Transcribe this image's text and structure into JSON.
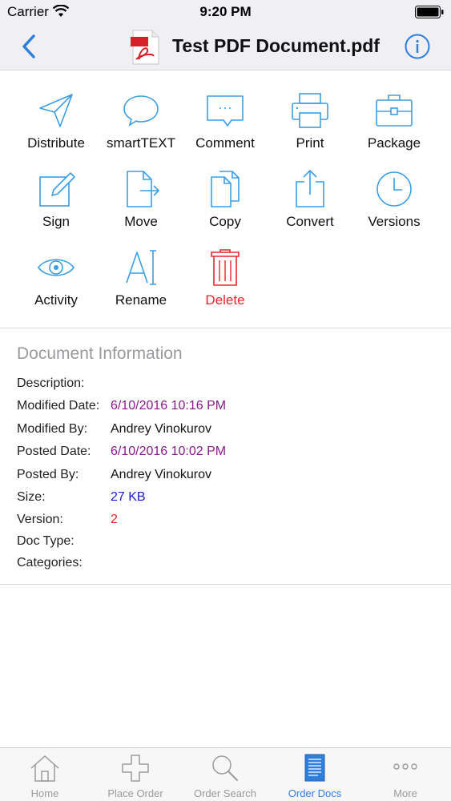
{
  "status_bar": {
    "carrier": "Carrier",
    "time": "9:20 PM"
  },
  "nav": {
    "title": "Test PDF Document.pdf",
    "back_icon": "chevron-left-icon",
    "info_icon": "info-icon"
  },
  "actions": [
    {
      "label": "Distribute",
      "icon": "paper-plane-icon"
    },
    {
      "label": "smartTEXT",
      "icon": "speech-bubble-icon"
    },
    {
      "label": "Comment",
      "icon": "comment-bubble-icon"
    },
    {
      "label": "Print",
      "icon": "printer-icon"
    },
    {
      "label": "Package",
      "icon": "briefcase-icon"
    },
    {
      "label": "Sign",
      "icon": "pencil-square-icon"
    },
    {
      "label": "Move",
      "icon": "document-arrow-icon"
    },
    {
      "label": "Copy",
      "icon": "documents-copy-icon"
    },
    {
      "label": "Convert",
      "icon": "share-upload-icon"
    },
    {
      "label": "Versions",
      "icon": "clock-icon"
    },
    {
      "label": "Activity",
      "icon": "eye-icon"
    },
    {
      "label": "Rename",
      "icon": "text-cursor-icon"
    },
    {
      "label": "Delete",
      "icon": "trash-icon"
    }
  ],
  "doc_info": {
    "heading": "Document Information",
    "description_label": "Description:",
    "modified_date_label": "Modified Date:",
    "modified_date": "6/10/2016 10:16 PM",
    "modified_by_label": "Modified By:",
    "modified_by": "Andrey Vinokurov",
    "posted_date_label": "Posted Date:",
    "posted_date": "6/10/2016 10:02 PM",
    "posted_by_label": "Posted By:",
    "posted_by": "Andrey Vinokurov",
    "size_label": "Size:",
    "size": "27 KB",
    "version_label": "Version:",
    "version": "2",
    "doc_type_label": "Doc Type:",
    "categories_label": "Categories:"
  },
  "tabs": [
    {
      "label": "Home",
      "icon": "house-icon",
      "active": false
    },
    {
      "label": "Place Order",
      "icon": "plus-icon",
      "active": false
    },
    {
      "label": "Order Search",
      "icon": "magnifier-icon",
      "active": false
    },
    {
      "label": "Order Docs",
      "icon": "document-list-icon",
      "active": true
    },
    {
      "label": "More",
      "icon": "more-dots-icon",
      "active": false
    }
  ],
  "colors": {
    "accent": "#2f7fde",
    "icon_blue": "#3a9ee4",
    "delete_red": "#e8262b",
    "date_purple": "#8a1a8c",
    "size_blue": "#1b1bd6"
  }
}
